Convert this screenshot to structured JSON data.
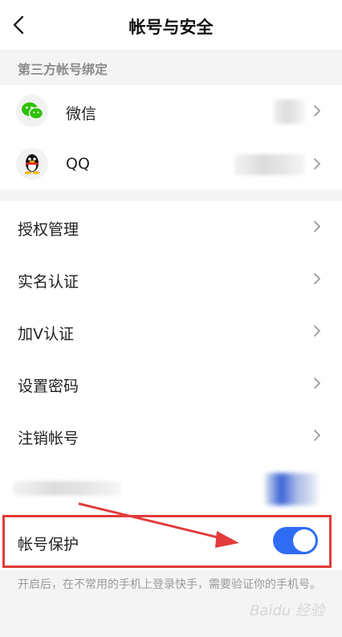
{
  "header": {
    "title": "帐号与安全",
    "back_icon": "chevron-left-icon"
  },
  "third_party": {
    "section_title": "第三方帐号绑定",
    "items": [
      {
        "label": "微信",
        "icon": "wechat-icon",
        "brand_color": "#2dc100"
      },
      {
        "label": "QQ",
        "icon": "qq-penguin-icon",
        "brand_color": "#111111"
      }
    ]
  },
  "menu": {
    "items": [
      {
        "label": "授权管理"
      },
      {
        "label": "实名认证"
      },
      {
        "label": "加V认证"
      },
      {
        "label": "设置密码"
      },
      {
        "label": "注销帐号"
      }
    ]
  },
  "protection": {
    "label": "帐号保护",
    "enabled": true,
    "toggle_color": "#2f6cf5",
    "hint": "开启后，在不常用的手机上登录快手，需要验证你的手机号。"
  },
  "annotation": {
    "highlight_color": "#e23b3b"
  },
  "watermark": "Baidu 经验"
}
